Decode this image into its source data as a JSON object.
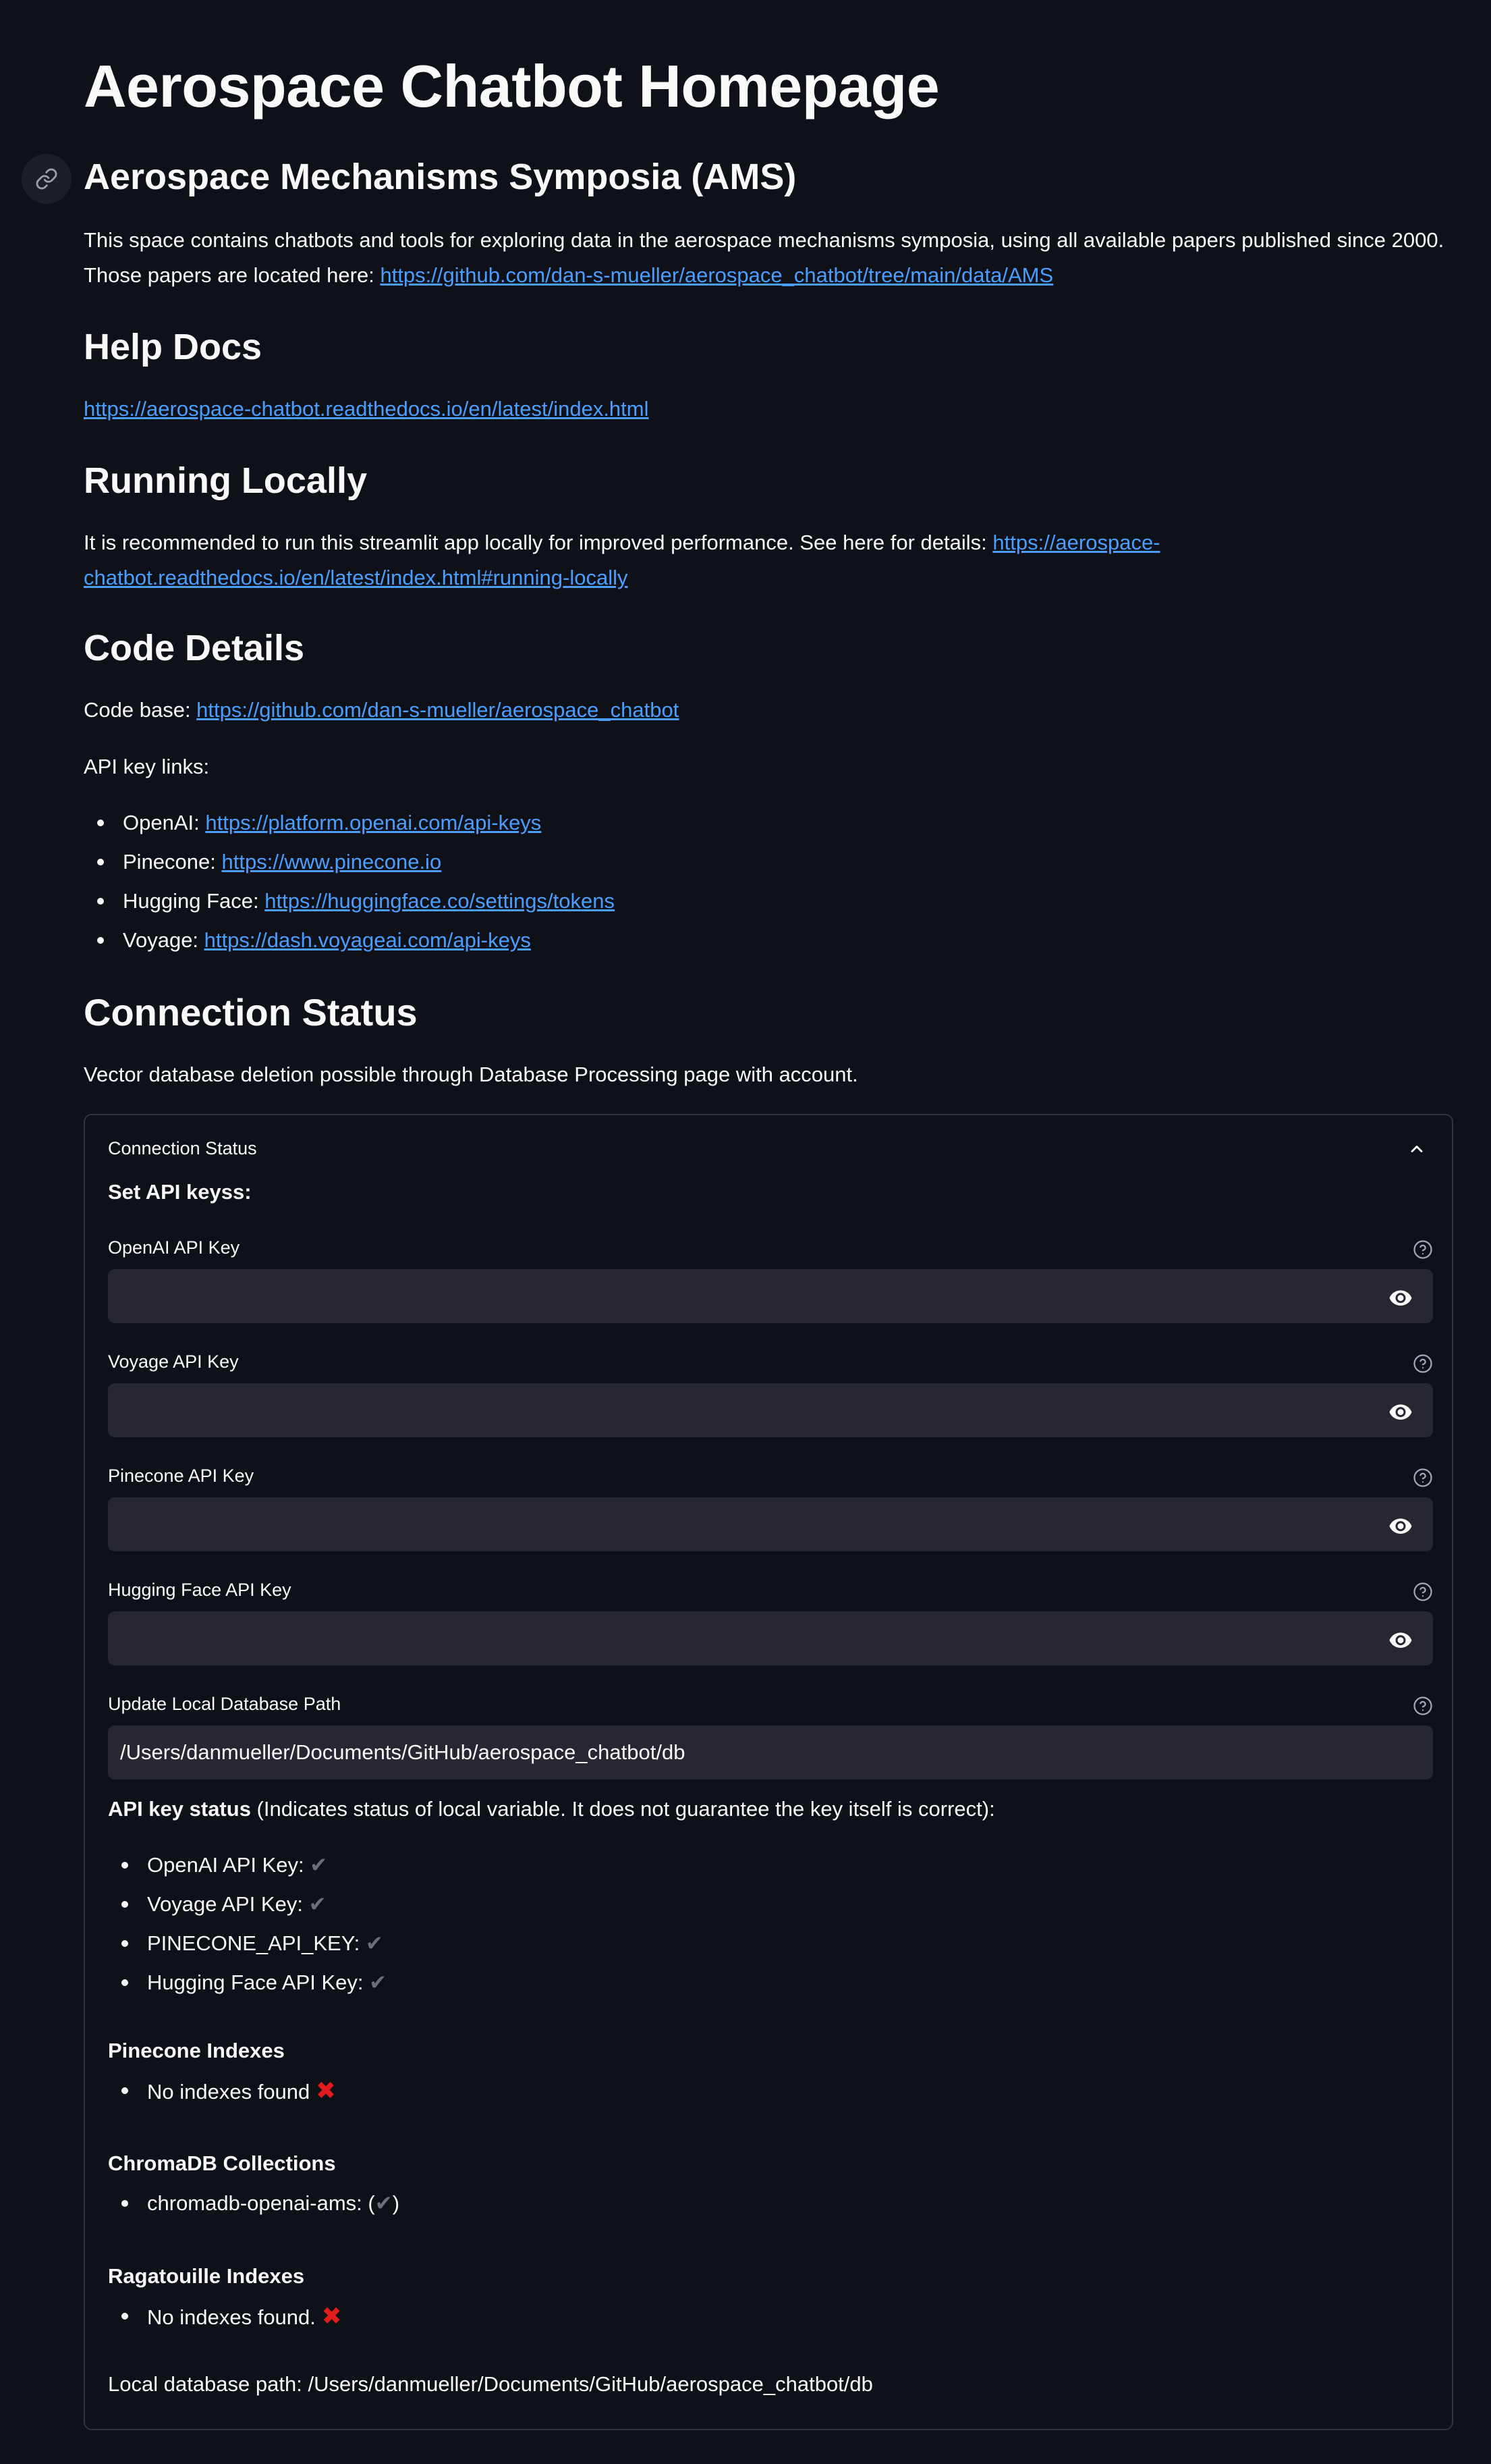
{
  "page": {
    "title": "Aerospace Chatbot Homepage"
  },
  "ams": {
    "heading": "Aerospace Mechanisms Symposia (AMS)",
    "text": "This space contains chatbots and tools for exploring data in the aerospace mechanisms symposia, using all available papers published since 2000. Those papers are located here: ",
    "link": "https://github.com/dan-s-mueller/aerospace_chatbot/tree/main/data/AMS"
  },
  "help": {
    "heading": "Help Docs",
    "link": "https://aerospace-chatbot.readthedocs.io/en/latest/index.html"
  },
  "running": {
    "heading": "Running Locally",
    "text": "It is recommended to run this streamlit app locally for improved performance. See here for details: ",
    "link": "https://aerospace-chatbot.readthedocs.io/en/latest/index.html#running-locally"
  },
  "code": {
    "heading": "Code Details",
    "codebase_label": "Code base: ",
    "codebase_link": "https://github.com/dan-s-mueller/aerospace_chatbot",
    "api_links_label": "API key links:",
    "api_links": [
      {
        "label": "OpenAI: ",
        "url": "https://platform.openai.com/api-keys"
      },
      {
        "label": "Pinecone: ",
        "url": "https://www.pinecone.io"
      },
      {
        "label": "Hugging Face: ",
        "url": "https://huggingface.co/settings/tokens"
      },
      {
        "label": "Voyage: ",
        "url": "https://dash.voyageai.com/api-keys"
      }
    ]
  },
  "connection": {
    "heading": "Connection Status",
    "text": "Vector database deletion possible through Database Processing page with account.",
    "expander": {
      "title": "Connection Status",
      "set_keys_label": "Set API keyss:",
      "fields": [
        {
          "label": "OpenAI API Key",
          "value": ""
        },
        {
          "label": "Voyage API Key",
          "value": ""
        },
        {
          "label": "Pinecone API Key",
          "value": ""
        },
        {
          "label": "Hugging Face API Key",
          "value": ""
        }
      ],
      "db_path_field": {
        "label": "Update Local Database Path",
        "value": "/Users/danmueller/Documents/GitHub/aerospace_chatbot/db"
      },
      "status_bold": "API key status",
      "status_rest": " (Indicates status of local variable. It does not guarantee the key itself is correct):",
      "status_items": [
        {
          "label": "OpenAI API Key: ",
          "mark": "✔"
        },
        {
          "label": "Voyage API Key: ",
          "mark": "✔"
        },
        {
          "label": "PINECONE_API_KEY: ",
          "mark": "✔"
        },
        {
          "label": "Hugging Face API Key: ",
          "mark": "✔"
        }
      ],
      "pinecone_heading": "Pinecone Indexes",
      "pinecone_item": "No indexes found ",
      "chroma_heading": "ChromaDB Collections",
      "chroma_item": "chromadb-openai-ams: (",
      "chroma_item_close": ")",
      "ragatouille_heading": "Ragatouille Indexes",
      "ragatouille_item": "No indexes found. ",
      "cross_mark": "✖",
      "check_mark": "✔",
      "local_path_text": "Local database path: /Users/danmueller/Documents/GitHub/aerospace_chatbot/db"
    }
  },
  "icons": {
    "anchor": "link-icon",
    "chevron": "chevron-up-icon",
    "help": "help-circle-icon",
    "eye": "eye-icon"
  }
}
